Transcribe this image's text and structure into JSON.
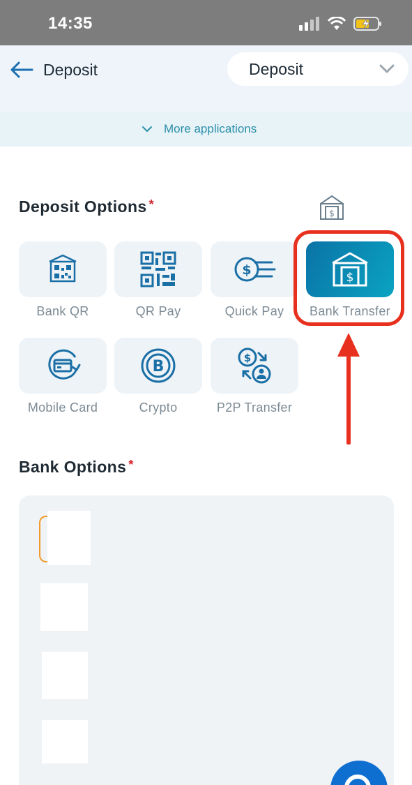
{
  "status_bar": {
    "time": "14:35"
  },
  "header": {
    "title": "Deposit",
    "selector_value": "Deposit"
  },
  "more_applications": {
    "label": "More applications"
  },
  "deposit_options": {
    "title": "Deposit Options",
    "required_mark": "*",
    "items": [
      {
        "label": "Bank QR",
        "icon": "bank-qr-icon",
        "selected": false
      },
      {
        "label": "QR Pay",
        "icon": "qr-code-icon",
        "selected": false
      },
      {
        "label": "Quick Pay",
        "icon": "quick-pay-icon",
        "selected": false
      },
      {
        "label": "Bank Transfer",
        "icon": "bank-transfer-icon",
        "selected": true
      },
      {
        "label": "Mobile Card",
        "icon": "mobile-card-icon",
        "selected": false
      },
      {
        "label": "Crypto",
        "icon": "bitcoin-icon",
        "selected": false
      },
      {
        "label": "P2P Transfer",
        "icon": "p2p-transfer-icon",
        "selected": false
      }
    ]
  },
  "bank_options": {
    "title": "Bank Options",
    "required_mark": "*"
  },
  "colors": {
    "accent": "#0a8fb8",
    "highlight": "#e8301f",
    "required": "#d4242a",
    "fab": "#0f6fd1"
  }
}
